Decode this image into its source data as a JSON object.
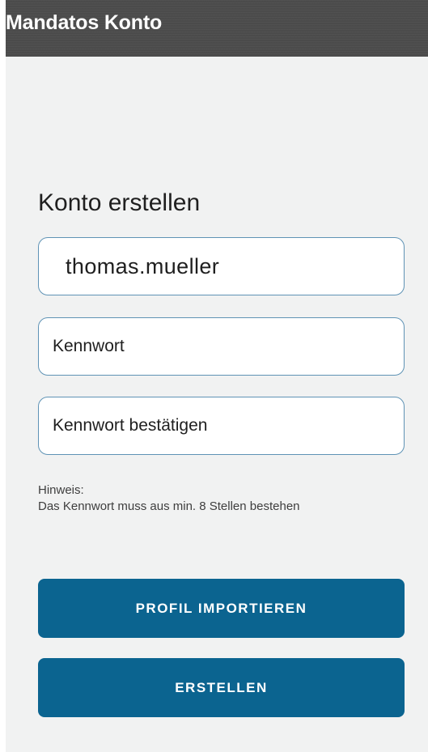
{
  "app_bar": {
    "title": "Mandatos Konto"
  },
  "form": {
    "title": "Konto erstellen",
    "username_value": "thomas.mueller",
    "password_placeholder": "Kennwort",
    "confirm_placeholder": "Kennwort bestätigen",
    "hint_label": "Hinweis:",
    "hint_text": "Das Kennwort muss aus min. 8 Stellen bestehen",
    "import_label": "PROFIL IMPORTIEREN",
    "create_label": "ERSTELLEN"
  },
  "colors": {
    "app_bar": "#4b4b4b",
    "background": "#f1f2f2",
    "field_border": "#5f93b5",
    "button": "#0b6490"
  }
}
